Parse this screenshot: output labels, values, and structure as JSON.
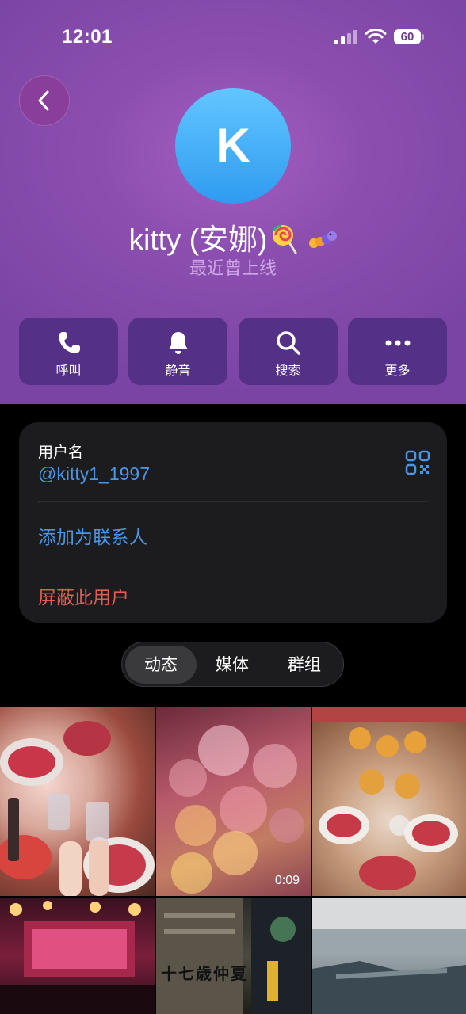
{
  "status_bar": {
    "time": "12:01",
    "battery": "60"
  },
  "profile": {
    "avatar_letter": "K",
    "name": "kitty (安娜)",
    "last_seen": "最近曾上线"
  },
  "actions": [
    {
      "label": "呼叫",
      "icon": "phone-icon"
    },
    {
      "label": "静音",
      "icon": "bell-icon"
    },
    {
      "label": "搜索",
      "icon": "search-icon"
    },
    {
      "label": "更多",
      "icon": "more-icon"
    }
  ],
  "info": {
    "username_label": "用户名",
    "username": "@kitty1_1997",
    "add_contact": "添加为联系人",
    "block_user": "屏蔽此用户"
  },
  "tabs": {
    "items": [
      "动态",
      "媒体",
      "群组"
    ],
    "selected": "动态"
  },
  "media": {
    "video_duration": "0:09",
    "thumb_text": "十七歳仲夏"
  },
  "colors": {
    "header_bg": "#8c4fb0",
    "action_bg": "#543086",
    "link_blue": "#4a96e6",
    "danger_red": "#e05c50",
    "card_bg": "#1c1c1e"
  }
}
